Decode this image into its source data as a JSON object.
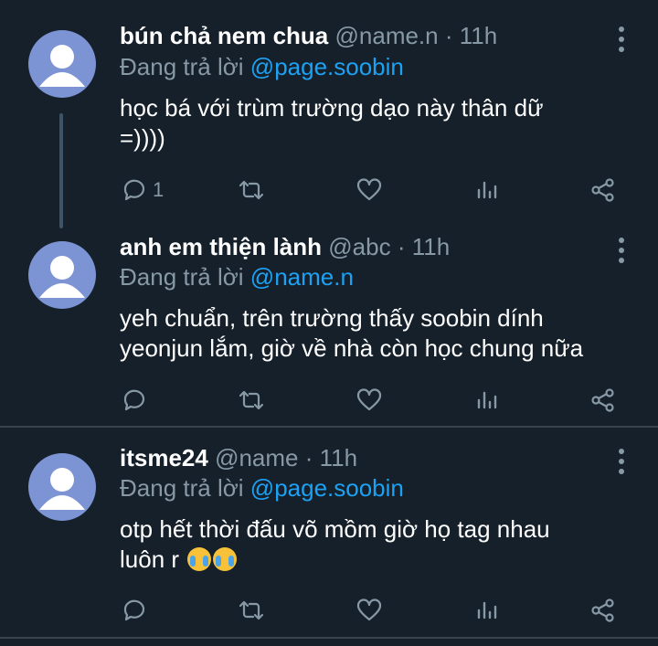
{
  "tweets": [
    {
      "name": "bún chả nem chua",
      "handle": "@name.n",
      "sep": "·",
      "time": "11h",
      "reply_prefix": "Đang trả lời",
      "reply_to": "@page.soobin",
      "text_line1": "học bá với trùm trường dạo này thân dữ",
      "text_line2": "=))))",
      "reply_count": "1"
    },
    {
      "name": "anh em thiện lành",
      "handle": "@abc",
      "sep": "·",
      "time": "11h",
      "reply_prefix": "Đang trả lời",
      "reply_to": "@name.n",
      "text_line1": "yeh chuẩn, trên trường thấy soobin dính",
      "text_line2": "yeonjun lắm, giờ về nhà còn học chung nữa",
      "reply_count": ""
    },
    {
      "name": "itsme24",
      "handle": "@name",
      "sep": "·",
      "time": "11h",
      "reply_prefix": "Đang trả lời",
      "reply_to": "@page.soobin",
      "text_line1": "otp hết thời đấu võ mồm giờ họ tag nhau",
      "text_line2": "luôn r",
      "emojis": [
        "loudly-crying-face",
        "loudly-crying-face"
      ],
      "reply_count": ""
    }
  ],
  "colors": {
    "background": "#15202b",
    "name": "#ffffff",
    "meta": "#8899a6",
    "mention": "#1da1f2",
    "divider": "#38444d",
    "avatar": "#7c94d4"
  },
  "icons": [
    "comment-icon",
    "retweet-icon",
    "like-icon",
    "analytics-icon",
    "share-icon",
    "more-icon"
  ]
}
